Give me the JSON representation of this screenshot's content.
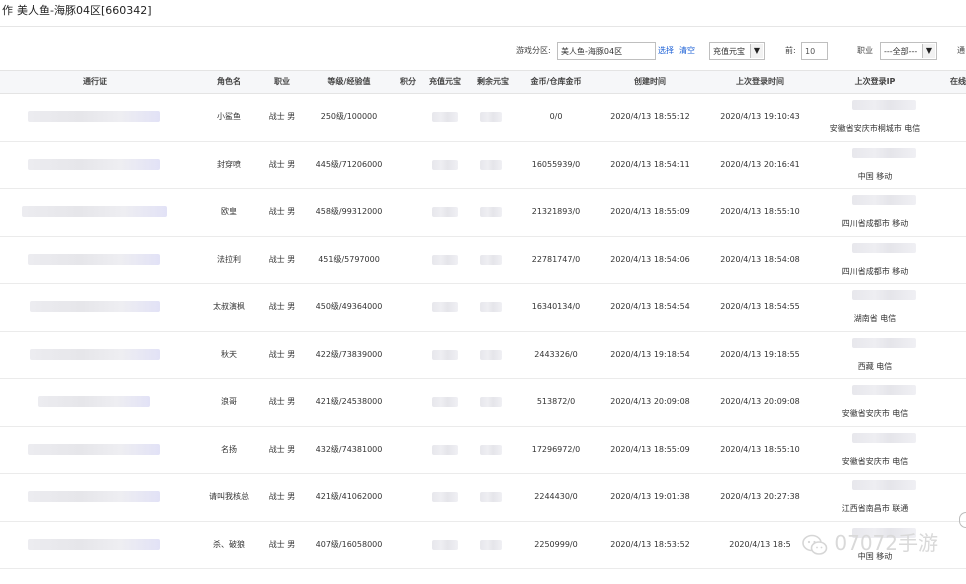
{
  "header": {
    "prefix": "作",
    "region": "美人鱼-海豚04区[660342]"
  },
  "filters": {
    "server_label": "游戏分区:",
    "server_value": "美人鱼-海豚04区",
    "select_link": "选择",
    "clear_link": "清空",
    "currency_value": "充值元宝",
    "threshold_label": "前:",
    "threshold_value": "10",
    "profession_label": "职业",
    "profession_value": "---全部---",
    "extra_label": "通"
  },
  "columns": [
    "通行证",
    "角色名",
    "职业",
    "等级/经验值",
    "积分",
    "充值元宝",
    "剩余元宝",
    "金币/仓库金币",
    "创建时间",
    "上次登录时间",
    "上次登录IP",
    "在线"
  ],
  "rows": [
    {
      "name": "小鲨鱼",
      "profession": "战士 男",
      "level": "250级/100000",
      "gold": "0/0",
      "created": "2020/4/13 18:55:12",
      "last_login": "2020/4/13 19:10:43",
      "ip_location": "安徽省安庆市桐城市 电信"
    },
    {
      "name": "封穿喷",
      "profession": "战士 男",
      "level": "445级/71206000",
      "gold": "16055939/0",
      "created": "2020/4/13 18:54:11",
      "last_login": "2020/4/13 20:16:41",
      "ip_location": "中国 移动"
    },
    {
      "name": "欧皇",
      "profession": "战士 男",
      "level": "458级/99312000",
      "gold": "21321893/0",
      "created": "2020/4/13 18:55:09",
      "last_login": "2020/4/13 18:55:10",
      "ip_location": "四川省成都市 移动"
    },
    {
      "name": "法拉利",
      "profession": "战士 男",
      "level": "451级/5797000",
      "gold": "22781747/0",
      "created": "2020/4/13 18:54:06",
      "last_login": "2020/4/13 18:54:08",
      "ip_location": "四川省成都市 移动"
    },
    {
      "name": "太叔演枫",
      "profession": "战士 男",
      "level": "450级/49364000",
      "gold": "16340134/0",
      "created": "2020/4/13 18:54:54",
      "last_login": "2020/4/13 18:54:55",
      "ip_location": "湖南省 电信"
    },
    {
      "name": "秋天",
      "profession": "战士 男",
      "level": "422级/73839000",
      "gold": "2443326/0",
      "created": "2020/4/13 19:18:54",
      "last_login": "2020/4/13 19:18:55",
      "ip_location": "西藏 电信"
    },
    {
      "name": "浪哥",
      "profession": "战士 男",
      "level": "421级/24538000",
      "gold": "513872/0",
      "created": "2020/4/13 20:09:08",
      "last_login": "2020/4/13 20:09:08",
      "ip_location": "安徽省安庆市 电信"
    },
    {
      "name": "名扬",
      "profession": "战士 男",
      "level": "432级/74381000",
      "gold": "17296972/0",
      "created": "2020/4/13 18:55:09",
      "last_login": "2020/4/13 18:55:10",
      "ip_location": "安徽省安庆市 电信"
    },
    {
      "name": "请叫我核总",
      "profession": "战士 男",
      "level": "421级/41062000",
      "gold": "2244430/0",
      "created": "2020/4/13 19:01:38",
      "last_login": "2020/4/13 20:27:38",
      "ip_location": "江西省南昌市 联通"
    },
    {
      "name": "杀、破狼",
      "profession": "战士 男",
      "level": "407级/16058000",
      "gold": "2250999/0",
      "created": "2020/4/13 18:53:52",
      "last_login": "2020/4/13 18:5",
      "ip_location": "中国 移动"
    }
  ],
  "watermark": {
    "text": "07072手游",
    "icon": "wechat-icon"
  }
}
